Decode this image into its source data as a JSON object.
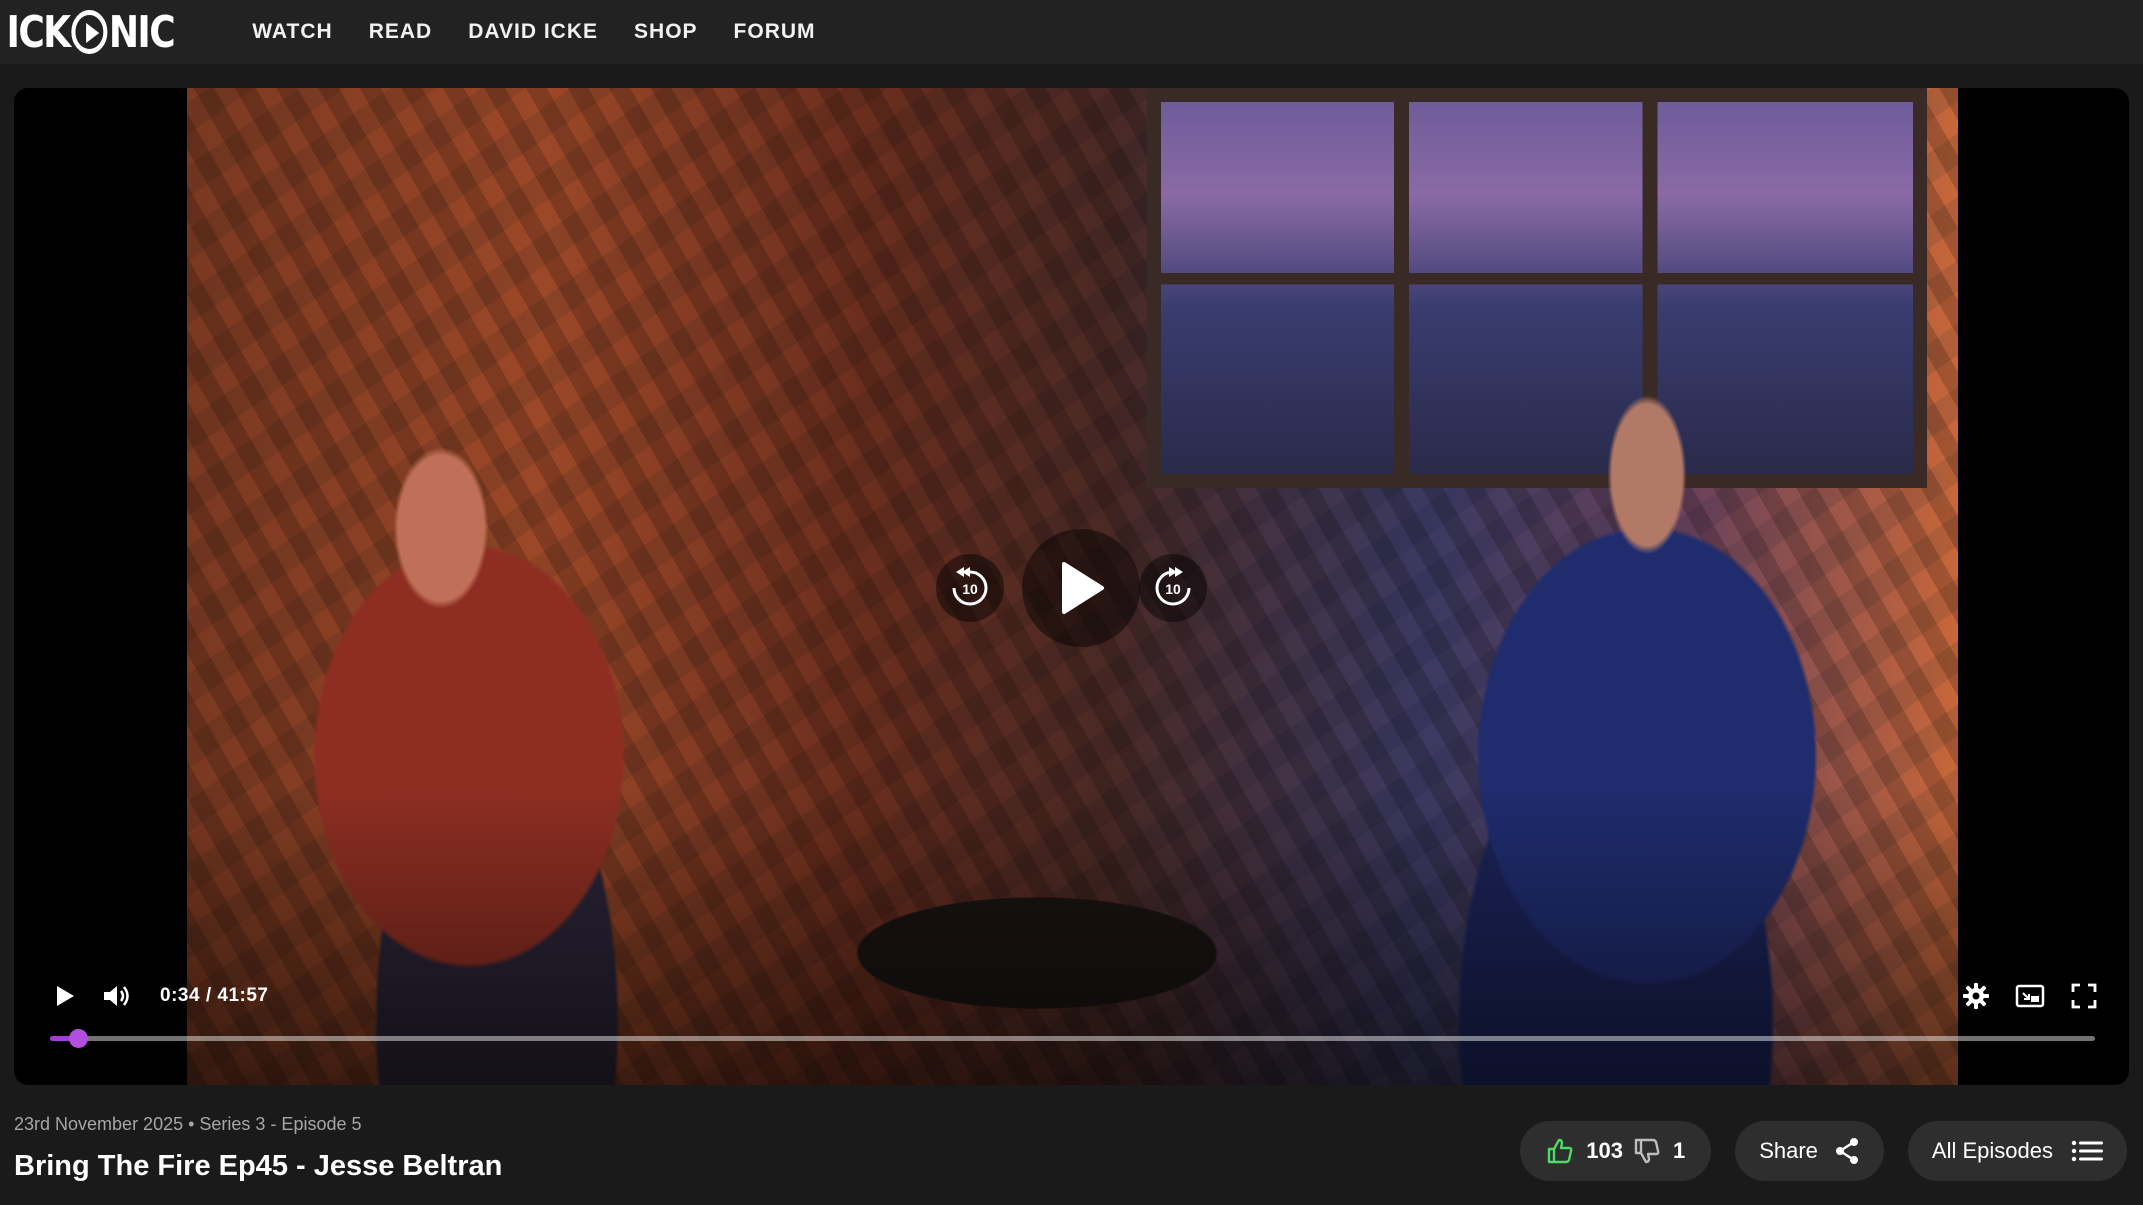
{
  "brand": {
    "logo_text_left": "ICK",
    "logo_text_right": "NIC",
    "logo_icon": "play-circle-icon"
  },
  "nav": {
    "items": [
      {
        "label": "WATCH"
      },
      {
        "label": "READ"
      },
      {
        "label": "DAVID ICKE"
      },
      {
        "label": "SHOP"
      },
      {
        "label": "FORUM"
      }
    ]
  },
  "player": {
    "current_time": "0:34",
    "separator": "/",
    "duration": "41:57",
    "progress_fraction": 0.0135,
    "accent_color": "#a33bd6",
    "skip_seconds_back": "10",
    "skip_seconds_forward": "10",
    "icons": {
      "play": "play-icon",
      "volume": "volume-icon",
      "settings": "gear-icon",
      "cast": "cast-icon",
      "fullscreen": "fullscreen-icon",
      "rewind": "rewind-10-icon",
      "forward": "forward-10-icon"
    }
  },
  "episode": {
    "meta": "23rd November 2025 • Series 3 - Episode 5",
    "title": "Bring The Fire Ep45 - Jesse Beltran",
    "likes": "103",
    "dislikes": "1",
    "share_label": "Share",
    "all_episodes_label": "All Episodes",
    "like_color": "#4cd964"
  }
}
